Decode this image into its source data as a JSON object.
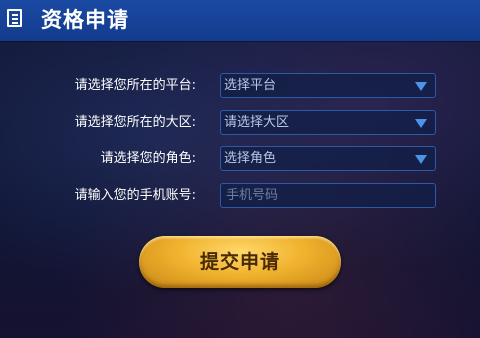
{
  "header": {
    "title": "资格申请",
    "icon": "document-list-icon"
  },
  "form": {
    "platform": {
      "label": "请选择您所在的平台:",
      "value": "选择平台"
    },
    "region": {
      "label": "请选择您所在的大区:",
      "value": "请选择大区"
    },
    "role": {
      "label": "请选择您的角色:",
      "value": "选择角色"
    },
    "phone": {
      "label": "请输入您的手机账号:",
      "placeholder": "手机号码"
    }
  },
  "submit": {
    "label": "提交申请"
  },
  "colors": {
    "header": "#1b4aa3",
    "accent": "#4c94ea",
    "button": "#f0b22e"
  }
}
